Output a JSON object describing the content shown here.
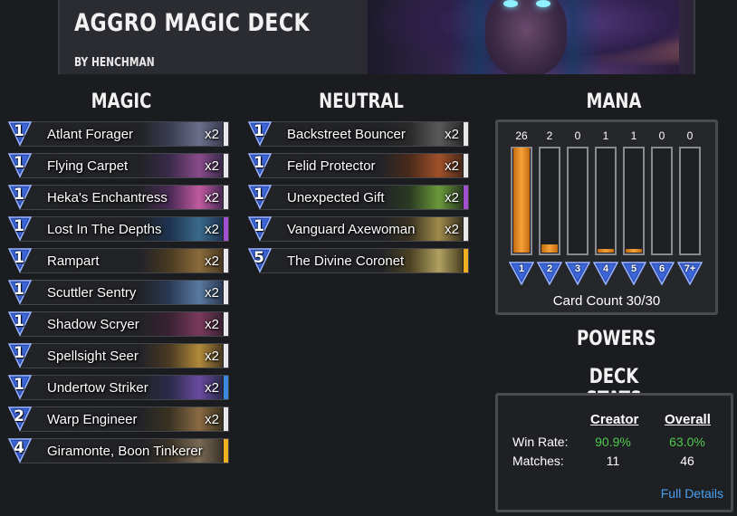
{
  "deck": {
    "title": "AGGRO MAGIC DECK",
    "author": "BY HENCHMAN"
  },
  "sections": {
    "magic": "MAGIC",
    "neutral": "NEUTRAL",
    "mana": "MANA",
    "powers": "POWERS",
    "deck_stats": "DECK STATS"
  },
  "magic_cards": [
    {
      "cost": "1",
      "name": "Atlant Forager",
      "count": "x2",
      "rarity": "#e8e8e8",
      "c1": "#3a3d52",
      "c2": "#6b6f8a"
    },
    {
      "cost": "1",
      "name": "Flying Carpet",
      "count": "x2",
      "rarity": "#e8e8e8",
      "c1": "#3a2a4a",
      "c2": "#8a4a8a"
    },
    {
      "cost": "1",
      "name": "Heka's Enchantress",
      "count": "x2",
      "rarity": "#e8e8e8",
      "c1": "#4a2a55",
      "c2": "#c05aa0"
    },
    {
      "cost": "1",
      "name": "Lost In The Depths",
      "count": "x2",
      "rarity": "#a050d0",
      "c1": "#1e3350",
      "c2": "#3a6a8a"
    },
    {
      "cost": "1",
      "name": "Rampart",
      "count": "x2",
      "rarity": "#e8e8e8",
      "c1": "#4a3a22",
      "c2": "#8a6a3a"
    },
    {
      "cost": "1",
      "name": "Scuttler Sentry",
      "count": "x2",
      "rarity": "#e8e8e8",
      "c1": "#2a3a55",
      "c2": "#5a7aa0"
    },
    {
      "cost": "1",
      "name": "Shadow Scryer",
      "count": "x2",
      "rarity": "#e8e8e8",
      "c1": "#3a2233",
      "c2": "#7a3a5a"
    },
    {
      "cost": "1",
      "name": "Spellsight Seer",
      "count": "x2",
      "rarity": "#e8e8e8",
      "c1": "#4a3a22",
      "c2": "#b08a3a"
    },
    {
      "cost": "1",
      "name": "Undertow Striker",
      "count": "x2",
      "rarity": "#3a8ae0",
      "c1": "#2a2a4a",
      "c2": "#6a4aa0"
    },
    {
      "cost": "2",
      "name": "Warp Engineer",
      "count": "x2",
      "rarity": "#e8e8e8",
      "c1": "#3a3322",
      "c2": "#8a6a44"
    },
    {
      "cost": "4",
      "name": "Giramonte, Boon Tinkerer",
      "count": "",
      "rarity": "#f0b020",
      "c1": "#3a3328",
      "c2": "#7a6a55"
    }
  ],
  "neutral_cards": [
    {
      "cost": "1",
      "name": "Backstreet Bouncer",
      "count": "x2",
      "rarity": "#e8e8e8",
      "c1": "#2a2a2a",
      "c2": "#5a5a5a"
    },
    {
      "cost": "1",
      "name": "Felid Protector",
      "count": "x2",
      "rarity": "#e8e8e8",
      "c1": "#4a2a1a",
      "c2": "#a0502a"
    },
    {
      "cost": "1",
      "name": "Unexpected Gift",
      "count": "x2",
      "rarity": "#a050d0",
      "c1": "#2a3a22",
      "c2": "#6a9a3a"
    },
    {
      "cost": "1",
      "name": "Vanguard Axewoman",
      "count": "x2",
      "rarity": "#e8e8e8",
      "c1": "#3a3322",
      "c2": "#a08a4a"
    },
    {
      "cost": "5",
      "name": "The Divine Coronet",
      "count": "",
      "rarity": "#f0b020",
      "c1": "#4a4022",
      "c2": "#b0a060"
    }
  ],
  "mana": {
    "counts": [
      "26",
      "2",
      "0",
      "1",
      "1",
      "0",
      "0"
    ],
    "fractions": [
      1.0,
      0.077,
      0,
      0.038,
      0.038,
      0,
      0
    ],
    "labels": [
      "1",
      "2",
      "3",
      "4",
      "5",
      "6",
      "7+"
    ],
    "card_count": "Card Count 30/30"
  },
  "stats": {
    "creator_label": "Creator",
    "overall_label": "Overall",
    "win_rate_label": "Win Rate:",
    "matches_label": "Matches:",
    "creator_win_rate": "90.9%",
    "overall_win_rate": "63.0%",
    "creator_matches": "11",
    "overall_matches": "46",
    "full_details": "Full Details",
    "positive_color": "#4ec94e"
  }
}
